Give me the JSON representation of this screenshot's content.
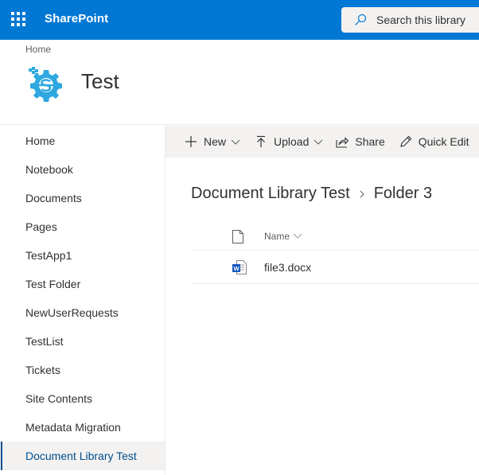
{
  "suite_bar": {
    "app_name": "SharePoint",
    "search_placeholder": "Search this library",
    "brand_color": "#0078d4"
  },
  "site_header": {
    "breadcrumb_home": "Home",
    "site_title": "Test",
    "logo_color": "#2ea8e0"
  },
  "left_nav": {
    "items": [
      {
        "label": "Home"
      },
      {
        "label": "Notebook"
      },
      {
        "label": "Documents"
      },
      {
        "label": "Pages"
      },
      {
        "label": "TestApp1"
      },
      {
        "label": "Test Folder"
      },
      {
        "label": "NewUserRequests"
      },
      {
        "label": "TestList"
      },
      {
        "label": "Tickets"
      },
      {
        "label": "Site Contents"
      },
      {
        "label": "Metadata Migration"
      },
      {
        "label": "Document Library Test",
        "active": true
      }
    ]
  },
  "command_bar": {
    "new_label": "New",
    "upload_label": "Upload",
    "share_label": "Share",
    "quick_edit_label": "Quick Edit"
  },
  "breadcrumb": {
    "library": "Document Library Test",
    "folder": "Folder 3"
  },
  "list": {
    "columns": [
      {
        "label": "Name",
        "sortable": true
      }
    ],
    "rows": [
      {
        "name": "file3.docx",
        "type": "word-document"
      }
    ]
  }
}
